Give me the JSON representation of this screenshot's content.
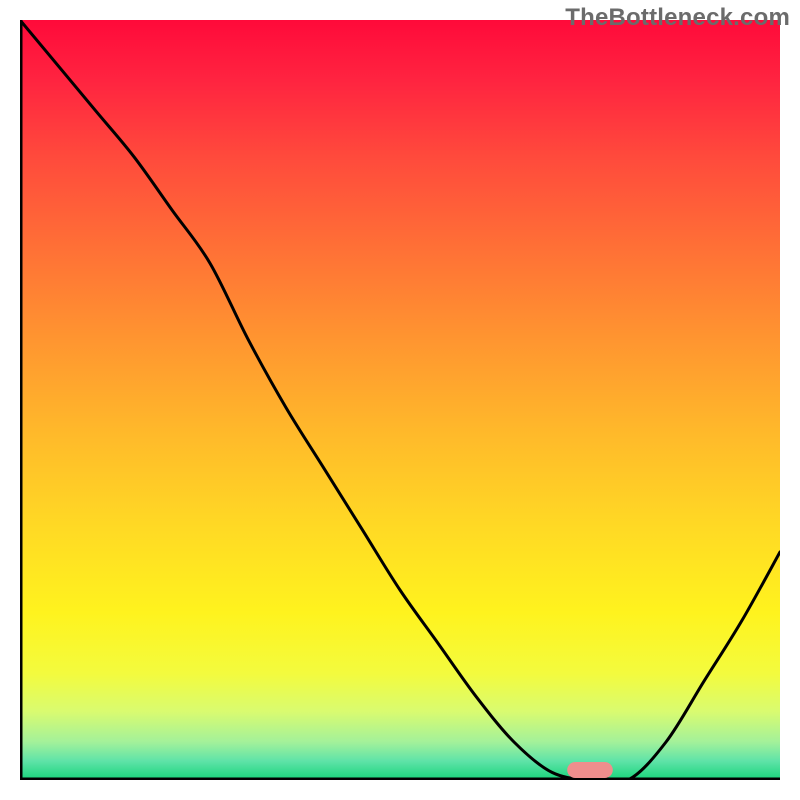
{
  "watermark": "TheBottleneck.com",
  "chart_data": {
    "type": "line",
    "title": "",
    "xlabel": "",
    "ylabel": "",
    "xlim": [
      0,
      100
    ],
    "ylim": [
      0,
      100
    ],
    "x": [
      0,
      5,
      10,
      15,
      20,
      25,
      30,
      35,
      40,
      45,
      50,
      55,
      60,
      65,
      70,
      75,
      80,
      85,
      90,
      95,
      100
    ],
    "values": [
      100,
      94,
      88,
      82,
      75,
      68,
      58,
      49,
      41,
      33,
      25,
      18,
      11,
      5,
      1,
      0,
      0,
      5,
      13,
      21,
      30
    ]
  },
  "gradient_stops": [
    {
      "offset": 0.0,
      "color": "#ff0a3a"
    },
    {
      "offset": 0.08,
      "color": "#ff2440"
    },
    {
      "offset": 0.18,
      "color": "#ff4a3c"
    },
    {
      "offset": 0.3,
      "color": "#ff7036"
    },
    {
      "offset": 0.42,
      "color": "#ff9530"
    },
    {
      "offset": 0.55,
      "color": "#ffbb2a"
    },
    {
      "offset": 0.67,
      "color": "#ffda24"
    },
    {
      "offset": 0.78,
      "color": "#fff31e"
    },
    {
      "offset": 0.86,
      "color": "#f3fb3e"
    },
    {
      "offset": 0.91,
      "color": "#d9fb70"
    },
    {
      "offset": 0.95,
      "color": "#a3f19a"
    },
    {
      "offset": 0.975,
      "color": "#5fe3a8"
    },
    {
      "offset": 1.0,
      "color": "#18d47a"
    }
  ],
  "marker": {
    "x_center": 75,
    "width_pct": 6,
    "color": "#ef8e8d"
  },
  "axes_color": "#000000",
  "line_color": "#000000"
}
